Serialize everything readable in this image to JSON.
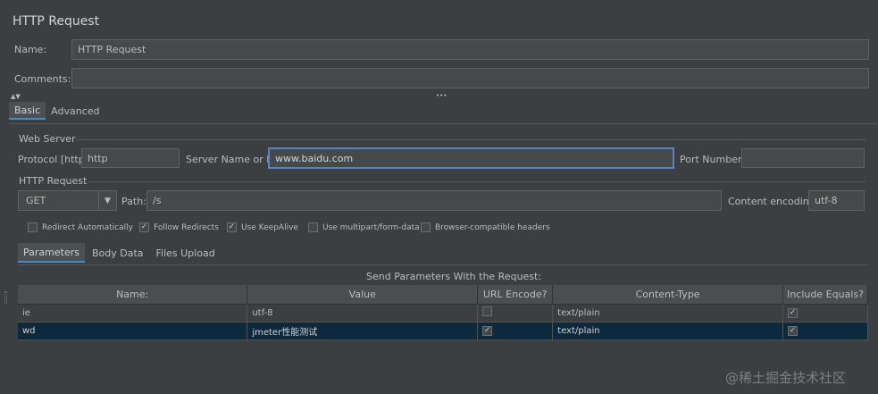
{
  "header": {
    "title": "HTTP Request"
  },
  "name_field": {
    "label": "Name:",
    "value": "HTTP Request"
  },
  "comments_field": {
    "label": "Comments:",
    "value": ""
  },
  "splitter": {
    "handle": "•••"
  },
  "tabs": [
    {
      "label": "Basic"
    },
    {
      "label": "Advanced"
    }
  ],
  "web_server": {
    "section_label": "Web Server",
    "protocol_label": "Protocol [http]:",
    "protocol_value": "http",
    "server_label": "Server Name or IP:",
    "server_value": "www.baidu.com",
    "port_label": "Port Number:",
    "port_value": ""
  },
  "http_request": {
    "section_label": "HTTP Request",
    "method": "GET",
    "path_label": "Path:",
    "path_value": "/s",
    "encoding_label": "Content encoding:",
    "encoding_value": "utf-8"
  },
  "options": [
    {
      "label": "Redirect Automatically",
      "checked": false
    },
    {
      "label": "Follow Redirects",
      "checked": true
    },
    {
      "label": "Use KeepAlive",
      "checked": true
    },
    {
      "label": "Use multipart/form-data",
      "checked": false
    },
    {
      "label": "Browser-compatible headers",
      "checked": false
    }
  ],
  "subtabs": [
    {
      "label": "Parameters"
    },
    {
      "label": "Body Data"
    },
    {
      "label": "Files Upload"
    }
  ],
  "params_caption": "Send Parameters With the Request:",
  "params_table": {
    "columns": [
      "Name:",
      "Value",
      "URL Encode?",
      "Content-Type",
      "Include Equals?"
    ],
    "rows": [
      {
        "name": "ie",
        "value": "utf-8",
        "url_encode": false,
        "content_type": "text/plain",
        "include_equals": true
      },
      {
        "name": "wd",
        "value": "jmeter性能测试",
        "url_encode": true,
        "content_type": "text/plain",
        "include_equals": true
      }
    ]
  },
  "watermark": "@稀土掘金技术社区"
}
